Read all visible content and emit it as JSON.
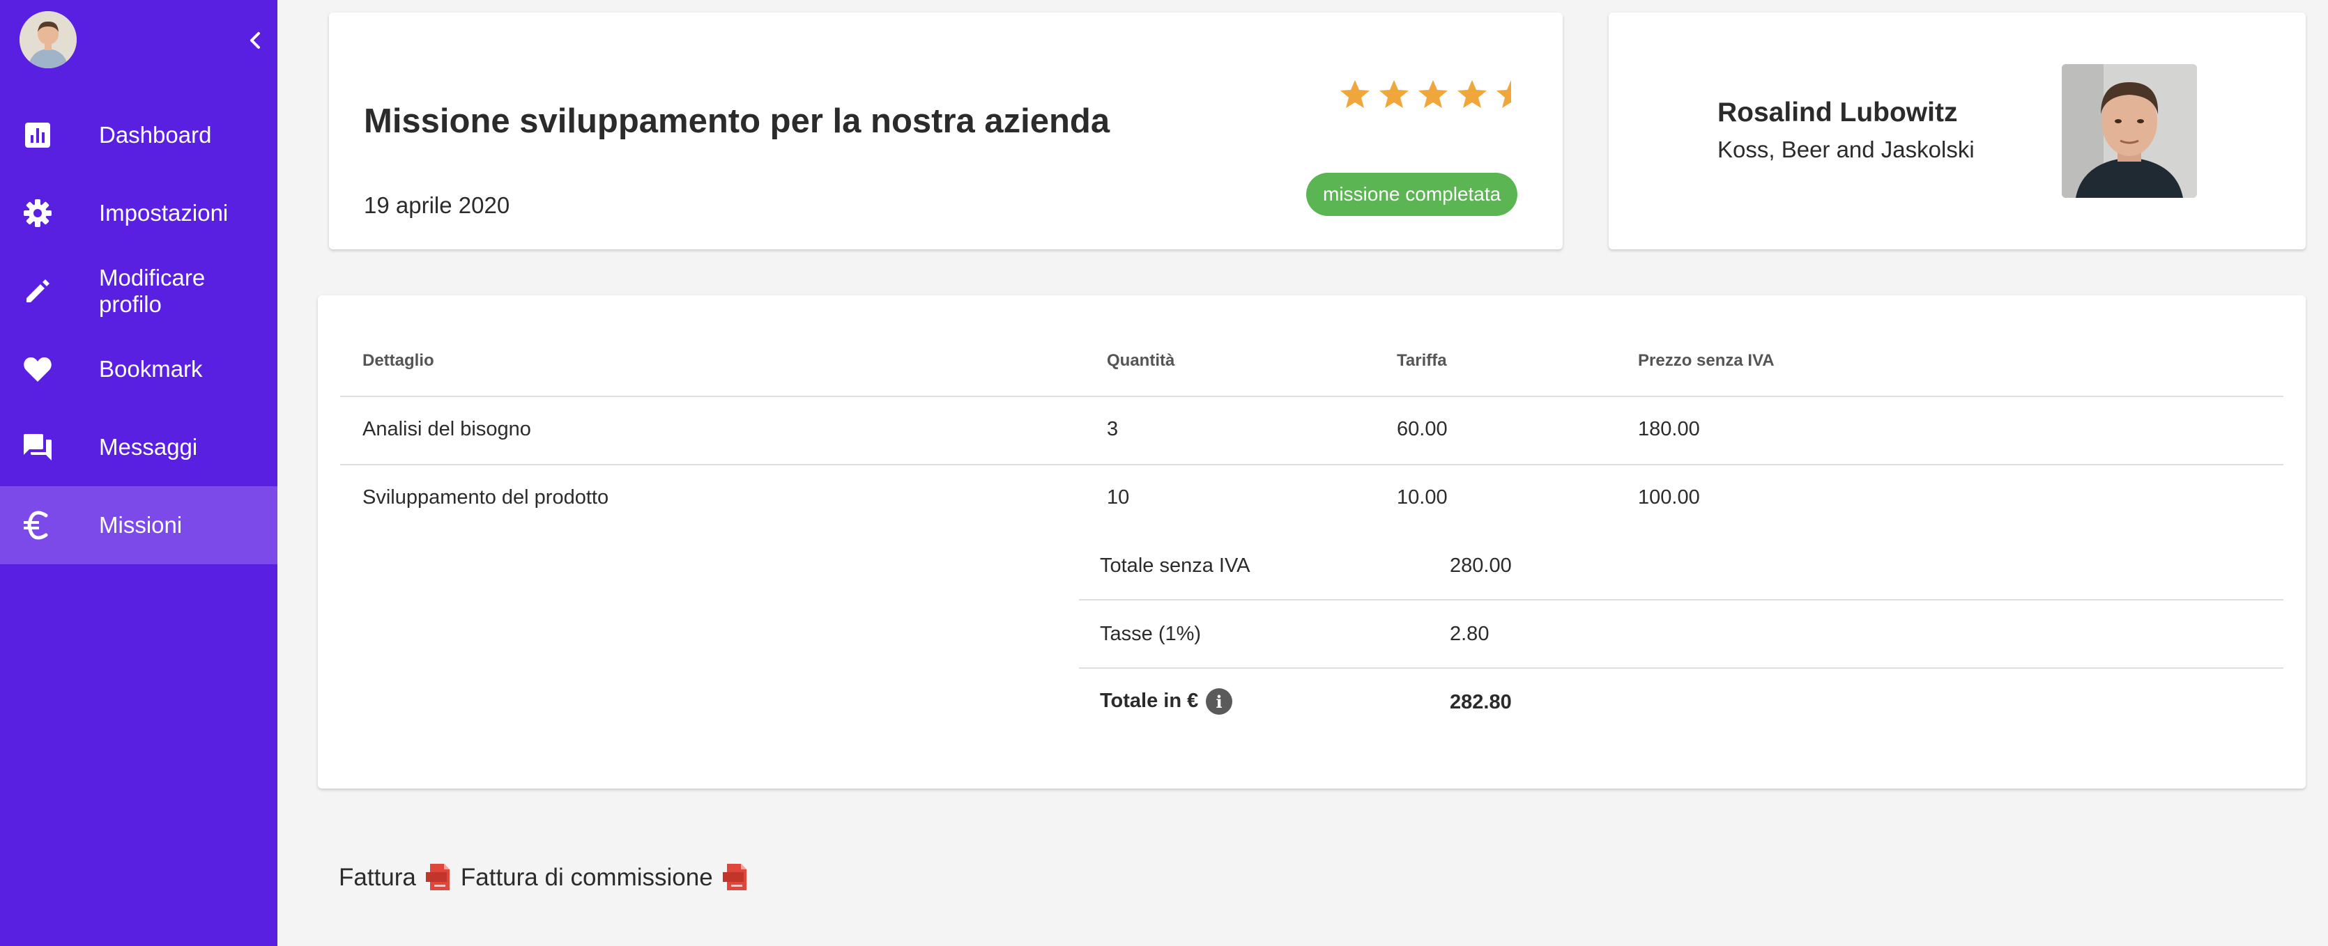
{
  "sidebar": {
    "items": [
      {
        "label": "Dashboard",
        "icon": "bar-chart-icon"
      },
      {
        "label": "Impostazioni",
        "icon": "gear-icon"
      },
      {
        "label": "Modificare profilo",
        "icon": "pencil-icon"
      },
      {
        "label": "Bookmark",
        "icon": "heart-icon"
      },
      {
        "label": "Messaggi",
        "icon": "chat-icon"
      },
      {
        "label": "Missioni",
        "icon": "euro-icon",
        "active": true
      }
    ]
  },
  "mission": {
    "title": "Missione sviluppamento per la nostra azienda",
    "date": "19 aprile 2020",
    "rating": 4.5,
    "rating_max": 5,
    "status": "missione completata"
  },
  "person": {
    "name": "Rosalind Lubowitz",
    "company": "Koss, Beer and Jaskolski"
  },
  "table": {
    "headers": [
      "Dettaglio",
      "Quantità",
      "Tariffa",
      "Prezzo senza IVA"
    ],
    "rows": [
      [
        "Analisi del bisogno",
        "3",
        "60.00",
        "180.00"
      ],
      [
        "Sviluppamento del prodotto",
        "10",
        "10.00",
        "100.00"
      ]
    ],
    "totals": {
      "subtotal_label": "Totale senza IVA",
      "subtotal_value": "280.00",
      "tax_label": "Tasse (1%)",
      "tax_value": "2.80",
      "total_label": "Totale in €",
      "total_value": "282.80"
    }
  },
  "footer": {
    "invoice_label": "Fattura",
    "commission_invoice_label": "Fattura di commissione"
  },
  "colors": {
    "sidebar": "#5920e2",
    "sidebar_active": "#7b4ae8",
    "badge": "#5ab552",
    "star": "#f0a63a",
    "pdf": "#e0473c"
  }
}
